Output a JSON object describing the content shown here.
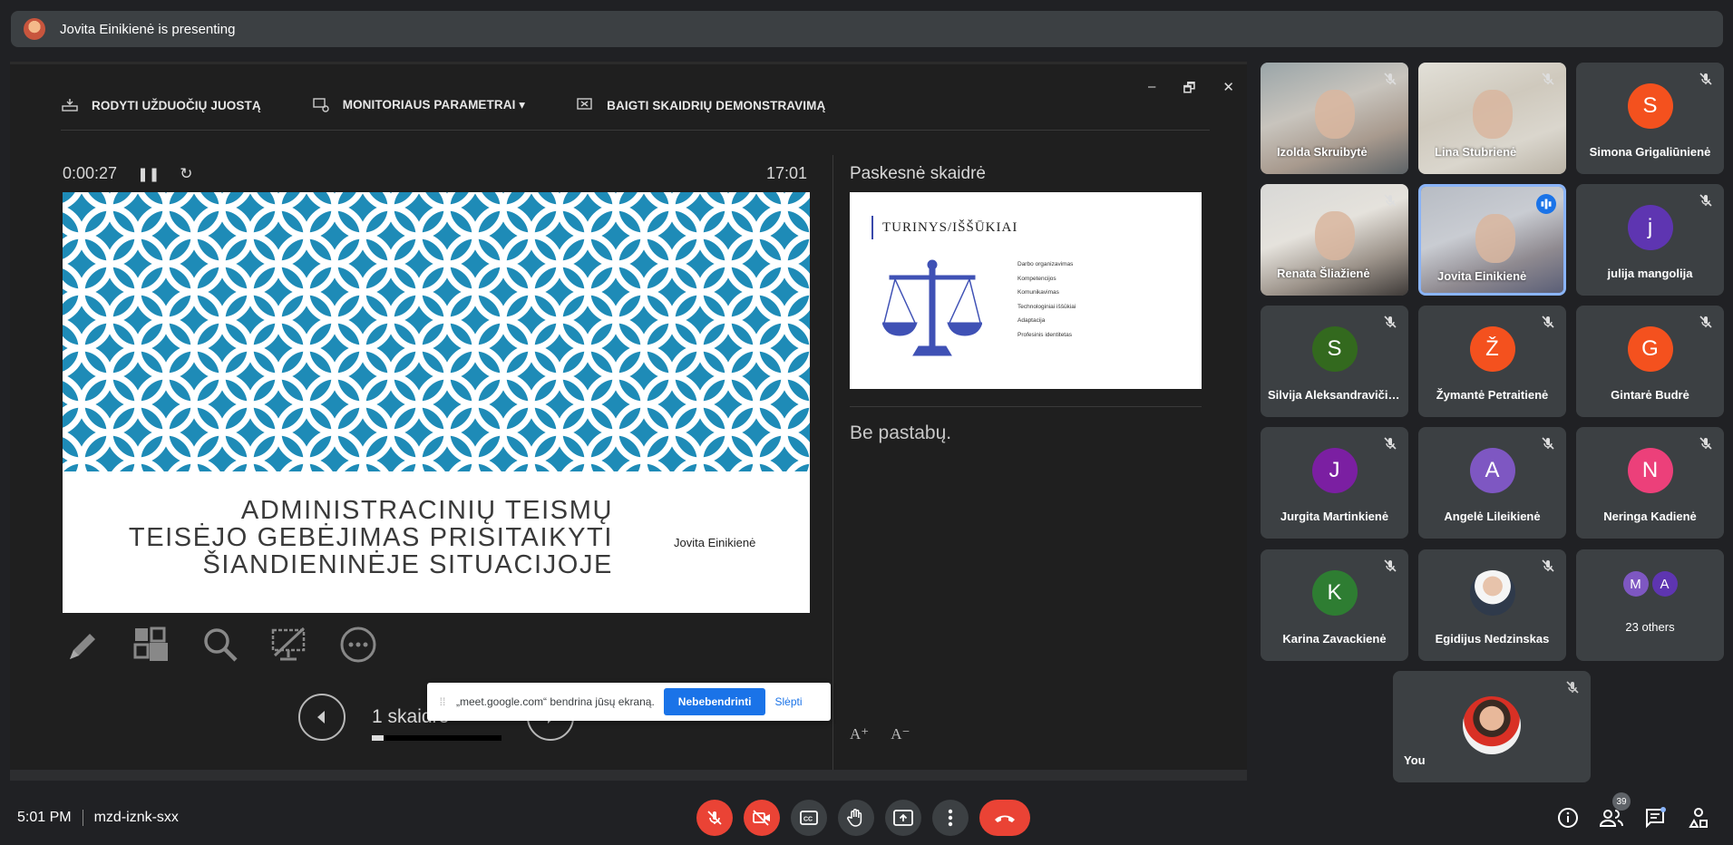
{
  "topbar": {
    "presenting_text": "Jovita Einikienė is presenting"
  },
  "presenter": {
    "toolbar": [
      "RODYTI UŽDUOČIŲ JUOSTĄ",
      "MONITORIAUS PARAMETRAI ▾",
      "BAIGTI SKAIDRIŲ DEMONSTRAVIMĄ"
    ],
    "window_controls": [
      "–",
      "🗗",
      "✕"
    ],
    "elapsed": "0:00:27",
    "clock": "17:01",
    "current_slide": {
      "title_lines": [
        "ADMINISTRACINIŲ TEISMŲ",
        "TEISĖJO GEBĖJIMAS PRISITAIKYTI",
        "ŠIANDIENINĖJE SITUACIJOJE"
      ],
      "author": "Jovita Einikienė"
    },
    "slide_counter": "1 skaidrė",
    "slide_progress": 0.09,
    "next_label": "Paskesnė skaidrė",
    "next_slide": {
      "title": "TURINYS/IŠŠŪKIAI",
      "items": [
        "Darbo organizavimas",
        "Kompetencijos",
        "Komunikavimas",
        "Technologiniai iššūkiai",
        "Adaptacija",
        "Profesinis identitetas"
      ]
    },
    "notes": "Be pastabų.",
    "font_buttons": [
      "A⁺",
      "A⁻"
    ]
  },
  "sharebar": {
    "text": "„meet.google.com“ bendrina jūsų ekraną.",
    "stop_label": "Nebebendrinti",
    "hide_label": "Slėpti"
  },
  "participants": [
    {
      "name": "Izolda Skruibytė",
      "type": "camera"
    },
    {
      "name": "Lina Stubrienė",
      "type": "camera"
    },
    {
      "name": "Simona Grigaliūnienė",
      "initial": "S",
      "color": "#f4511e"
    },
    {
      "name": "Renata Šliažienė",
      "type": "camera"
    },
    {
      "name": "Jovita Einikienė",
      "type": "camera",
      "speaking": true
    },
    {
      "name": "julija mangolija",
      "initial": "j",
      "color": "#5e35b1"
    },
    {
      "name": "Silvija Aleksandravičienė",
      "initial": "S",
      "color": "#33691e"
    },
    {
      "name": "Žymantė Petraitienė",
      "initial": "Ž",
      "color": "#f4511e"
    },
    {
      "name": "Gintarė Budrė",
      "initial": "G",
      "color": "#f4511e"
    },
    {
      "name": "Jurgita Martinkienė",
      "initial": "J",
      "color": "#7b1fa2"
    },
    {
      "name": "Angelė Lileikienė",
      "initial": "A",
      "color": "#7e57c2"
    },
    {
      "name": "Neringa Kadienė",
      "initial": "N",
      "color": "#ec407a"
    },
    {
      "name": "Karina Zavackienė",
      "initial": "K",
      "color": "#2e7d32"
    },
    {
      "name": "Egidijus Nedzinskas",
      "type": "photo"
    }
  ],
  "others": {
    "label": "23 others",
    "initials": [
      "M",
      "A"
    ]
  },
  "self": {
    "name": "You"
  },
  "bottom": {
    "time": "5:01 PM",
    "meeting_code": "mzd-iznk-sxx",
    "participant_count": "39"
  },
  "colors": {
    "slide_pattern": "#1e8bb7",
    "end_call": "#ea4335",
    "active_border": "#8ab4f8",
    "share_button": "#1a73e8"
  }
}
